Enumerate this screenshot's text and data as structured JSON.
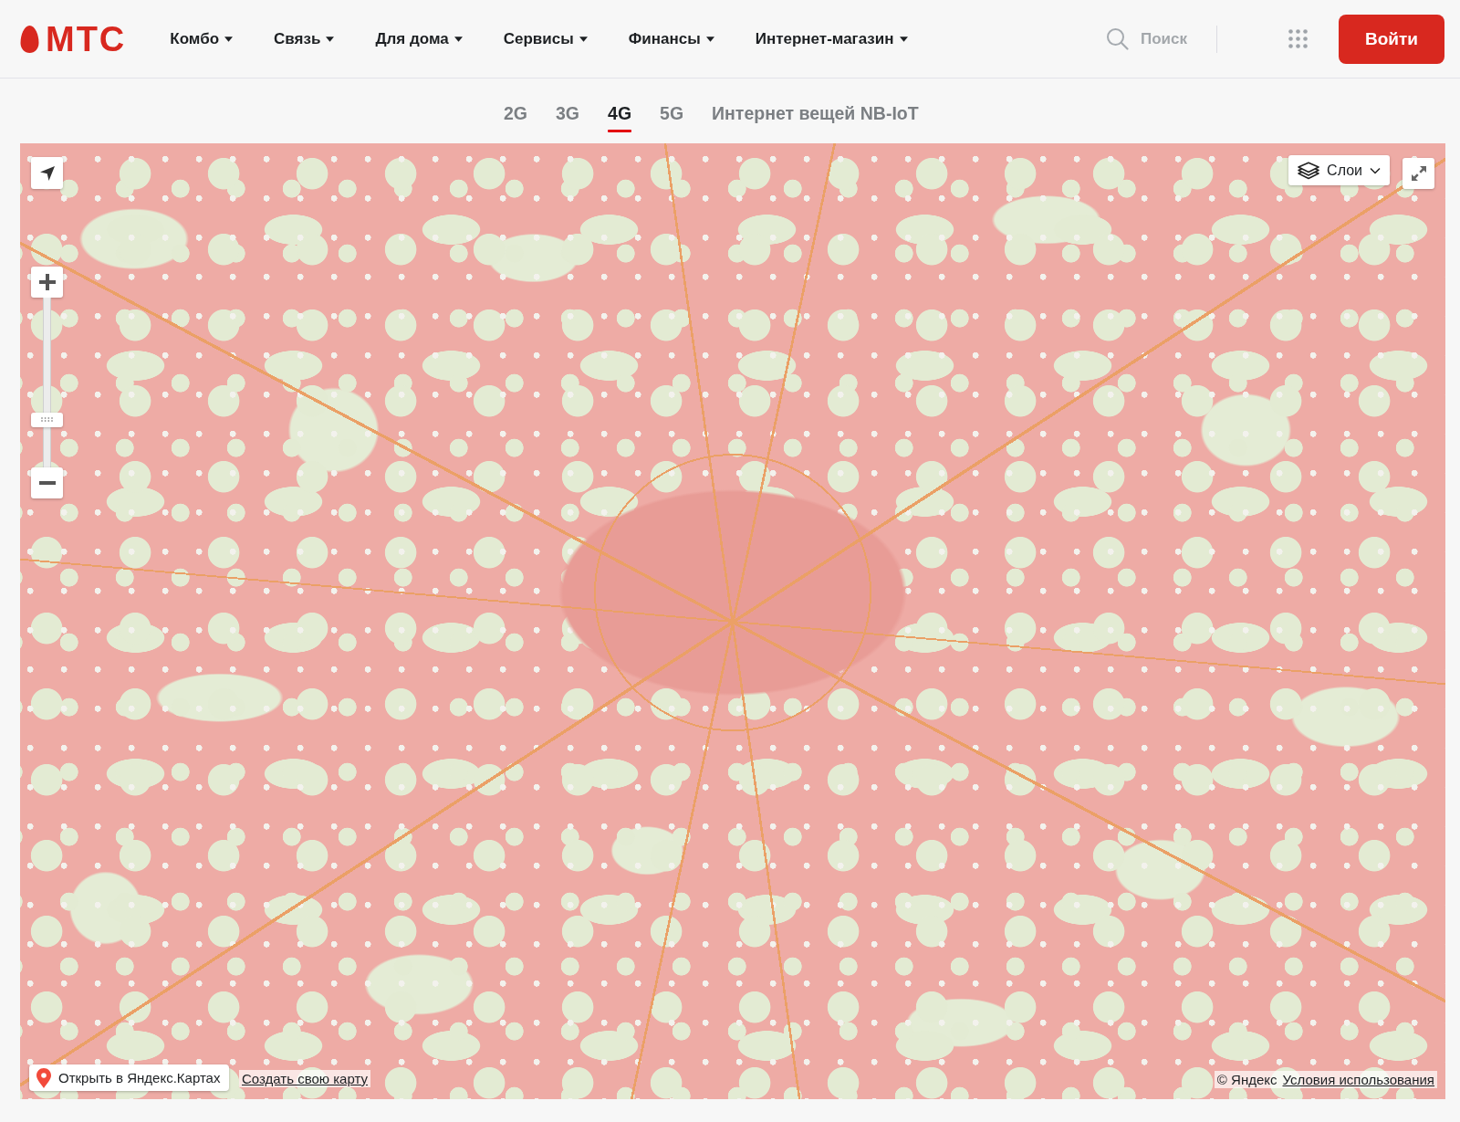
{
  "header": {
    "logo": "МТС",
    "nav": [
      {
        "label": "Комбо"
      },
      {
        "label": "Связь"
      },
      {
        "label": "Для дома"
      },
      {
        "label": "Сервисы"
      },
      {
        "label": "Финансы"
      },
      {
        "label": "Интернет-магазин"
      }
    ],
    "search": {
      "placeholder": "Поиск"
    },
    "login_button": "Войти"
  },
  "network_tabs": [
    {
      "label": "2G",
      "selected": false
    },
    {
      "label": "3G",
      "selected": false
    },
    {
      "label": "4G",
      "selected": true
    },
    {
      "label": "5G",
      "selected": false
    },
    {
      "label": "Интернет вещей NB-IoT",
      "selected": false
    }
  ],
  "map": {
    "zoom_slider": {
      "level": 0.26
    },
    "layers_button": "Слои",
    "open_link": "Открыть в Яндекс.Картах",
    "create_map_link": "Создать свою карту",
    "copyright": "© Яндекс",
    "terms_link": "Условия использования"
  }
}
